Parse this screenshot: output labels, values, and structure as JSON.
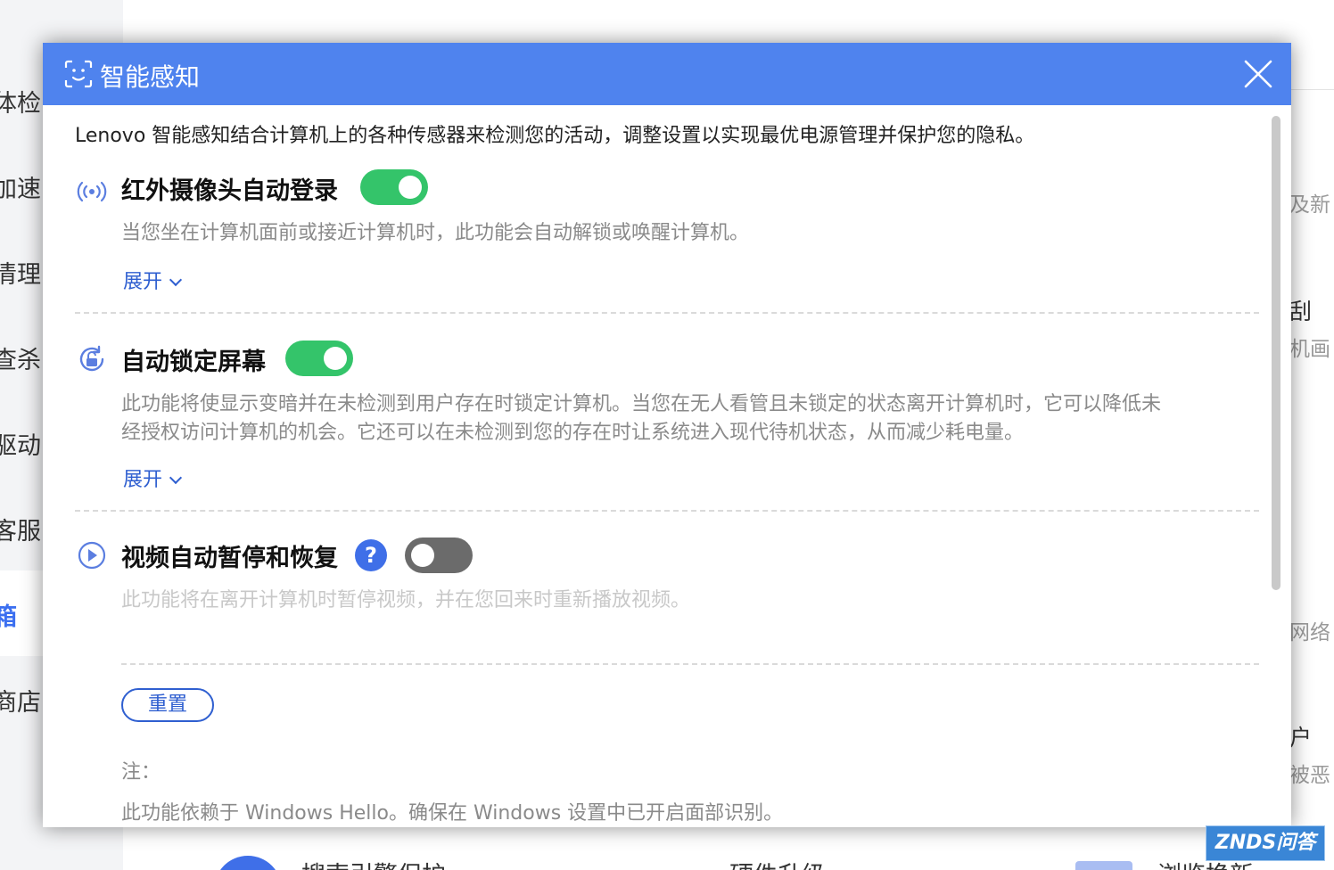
{
  "background": {
    "sidebar": [
      "体检",
      "加速",
      "清理",
      "查杀",
      "驱动",
      "客服",
      "箱",
      "商店"
    ],
    "right_texts": [
      "及新",
      "刮",
      "机画",
      "网络",
      "户",
      "被恶"
    ],
    "bottom_texts": [
      "搜索引擎保护",
      "硬件升级",
      "浏览换新"
    ]
  },
  "dialog": {
    "icon": "face-scan-icon",
    "title": "智能感知",
    "close_icon": "close-icon",
    "intro": "Lenovo 智能感知结合计算机上的各种传感器来检测您的活动，调整设置以实现最优电源管理并保护您的隐私。",
    "features": [
      {
        "icon": "infrared-signal-icon",
        "title": "红外摄像头自动登录",
        "enabled": true,
        "description": "当您坐在计算机面前或接近计算机时，此功能会自动解锁或唤醒计算机。",
        "expand_label": "展开"
      },
      {
        "icon": "lock-rotate-icon",
        "title": "自动锁定屏幕",
        "enabled": true,
        "description_lines": [
          "此功能将使显示变暗并在未检测到用户存在时锁定计算机。当您在无人看管且未锁定的状态离开计算机时，它可以降低未",
          "经授权访问计算机的机会。它还可以在未检测到您的存在时让系统进入现代待机状态，从而减少耗电量。"
        ],
        "expand_label": "展开"
      },
      {
        "icon": "play-circle-icon",
        "title": "视频自动暂停和恢复",
        "help": "?",
        "enabled": false,
        "description": "此功能将在离开计算机时暂停视频，并在您回来时重新播放视频。"
      }
    ],
    "reset_label": "重置",
    "note_label": "注：",
    "note_text": "此功能依赖于 Windows Hello。确保在 Windows 设置中已开启面部识别。"
  },
  "watermark": "ZNDS问答",
  "colors": {
    "header": "#4f83ee",
    "toggle_on": "#34c46a",
    "toggle_off": "#6b6b6b",
    "link": "#2f5fd0"
  }
}
